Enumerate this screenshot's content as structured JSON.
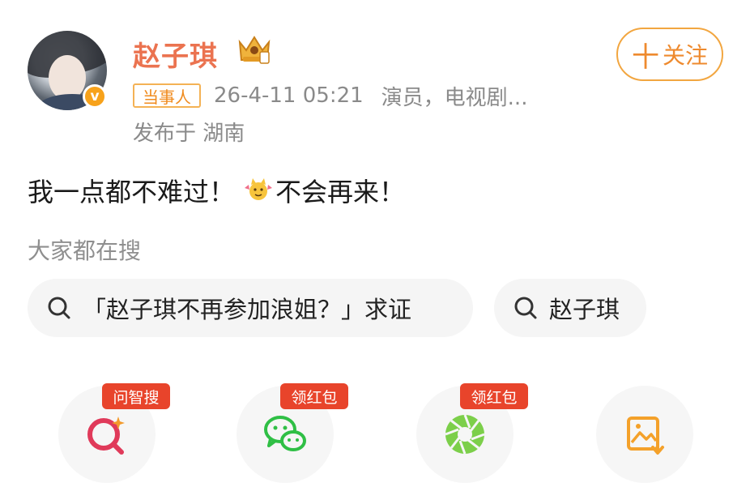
{
  "post": {
    "username": "赵子琪",
    "tag": "当事人",
    "timestamp": "26-4-11 05:21",
    "role": "演员，电视剧...",
    "location": "发布于 湖南",
    "follow_label": "关注",
    "follow_plus": "十",
    "content_before": "我一点都不难过！",
    "content_after": "不会再来！",
    "verified_badge": "v"
  },
  "search": {
    "title": "大家都在搜",
    "chips": [
      {
        "label": "「赵子琪不再参加浪姐？」求证"
      },
      {
        "label": "赵子琪"
      }
    ]
  },
  "actions": [
    {
      "icon": "ai-search-icon",
      "badge": "问智搜"
    },
    {
      "icon": "wechat-icon",
      "badge": "领红包"
    },
    {
      "icon": "moments-icon",
      "badge": "领红包"
    },
    {
      "icon": "save-image-icon",
      "badge": ""
    }
  ],
  "colors": {
    "username": "#eb7350",
    "follow": "#ee8a2e",
    "badge": "#e8442b",
    "verified": "#f7a21b"
  }
}
